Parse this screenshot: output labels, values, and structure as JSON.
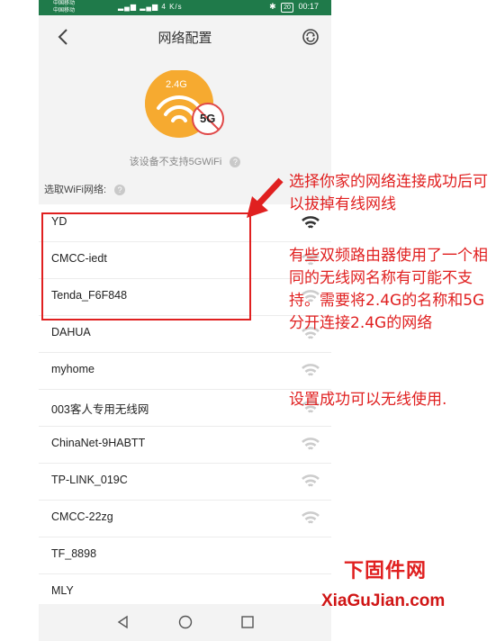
{
  "status_bar": {
    "carrier_1": "中国移动",
    "carrier_2": "中国移动",
    "net_speed": "4 K/s",
    "battery": "20",
    "time": "00:17"
  },
  "header": {
    "title": "网络配置"
  },
  "hero": {
    "badge_24": "2.4G",
    "badge_5g": "5G"
  },
  "warning": {
    "text": "该设备不支持5GWiFi"
  },
  "select_label": "选取WiFi网络:",
  "wifi_list": [
    {
      "name": "YD"
    },
    {
      "name": "CMCC-iedt"
    },
    {
      "name": "Tenda_F6F848"
    },
    {
      "name": "DAHUA"
    },
    {
      "name": "myhome"
    },
    {
      "name": "003客人专用无线网"
    },
    {
      "name": "ChinaNet-9HABTT"
    },
    {
      "name": "TP-LINK_019C"
    },
    {
      "name": "CMCC-22zg"
    },
    {
      "name": "TF_8898"
    },
    {
      "name": "MLY"
    }
  ],
  "annotations": {
    "note_1": "选择你家的网络连接成功后可以拔掉有线网线",
    "note_2": "有些双频路由器使用了一个相同的无线网名称有可能不支持。需要将2.4G的名称和5G分开连接2.4G的网络",
    "note_3": "设置成功可以无线使用."
  },
  "watermark": {
    "cn": "下固件网",
    "en": "XiaGuJian.com"
  },
  "colors": {
    "status_bar": "#1f7a4a",
    "annotation_red": "#e02020",
    "hero_orange": "#f5a21f"
  }
}
